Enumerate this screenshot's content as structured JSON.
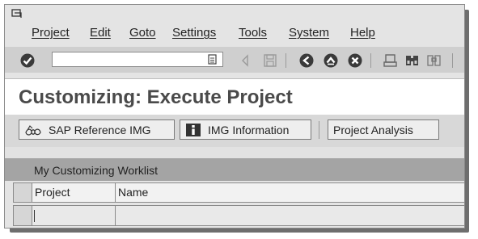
{
  "menubar": {
    "items": [
      {
        "label": "Project"
      },
      {
        "label": "Edit"
      },
      {
        "label": "Goto"
      },
      {
        "label": "Settings"
      },
      {
        "label": "Tools"
      },
      {
        "label": "System"
      },
      {
        "label": "Help"
      }
    ]
  },
  "toolbar": {
    "command_field_value": "",
    "icons": [
      "enter-icon",
      "save-icon",
      "back-icon",
      "exit-icon",
      "cancel-icon",
      "print-icon",
      "find-icon",
      "find-next-icon"
    ]
  },
  "page": {
    "title": "Customizing: Execute Project"
  },
  "application_toolbar": {
    "sap_reference_img_label": "SAP Reference IMG",
    "img_information_label": "IMG Information",
    "project_analysis_label": "Project Analysis"
  },
  "worklist": {
    "title": "My Customizing Worklist",
    "columns": [
      "Project",
      "Name"
    ],
    "rows": [
      {
        "project": "",
        "name": ""
      }
    ]
  },
  "colors": {
    "toolbar_bg": "#cfcfcf",
    "worklist_header_bg": "#a4a4a4",
    "title_text": "#4a4a4a"
  }
}
